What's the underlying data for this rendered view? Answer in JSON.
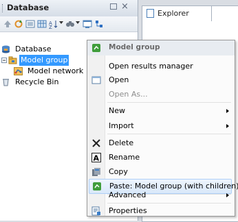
{
  "database_panel": {
    "title": "Database",
    "close_glyph": "×",
    "tree": [
      {
        "label": "Database",
        "icon": "database-icon"
      },
      {
        "label": "Model group",
        "icon": "model-group-icon",
        "selected": true
      },
      {
        "label": "Model network",
        "icon": "model-network-icon"
      },
      {
        "label": "Recycle Bin",
        "icon": "recycle-bin-icon"
      }
    ]
  },
  "explorer": {
    "tab_label": "Explorer"
  },
  "context_menu": {
    "header": "Model group",
    "items": {
      "open_results_manager": "Open results manager",
      "open": "Open",
      "open_as": "Open As...",
      "new": "New",
      "import": "Import",
      "delete": "Delete",
      "rename": "Rename",
      "copy": "Copy",
      "paste": "Paste: Model group (with children)",
      "advanced": "Advanced",
      "properties": "Properties"
    }
  },
  "colors": {
    "selection": "#3399ff",
    "menu_highlight": "#d9e8fa",
    "panel_header": "#d6dde7"
  }
}
